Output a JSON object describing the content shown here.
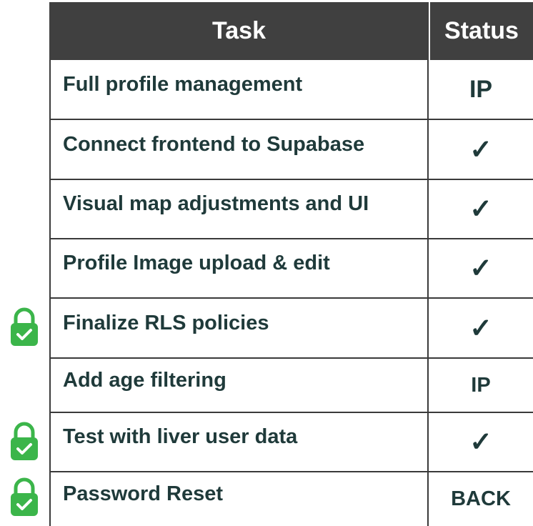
{
  "header": {
    "task": "Task",
    "status": "Status"
  },
  "rows": [
    {
      "task": "Full profile management",
      "status": "IP",
      "locked": false
    },
    {
      "task": "Connect frontend to Supabase",
      "status": "✓",
      "locked": false
    },
    {
      "task": "Visual map adjustments and UI",
      "status": "✓",
      "locked": false
    },
    {
      "task": "Profile Image upload & edit",
      "status": "✓",
      "locked": false
    },
    {
      "task": "Finalize RLS policies",
      "status": "✓",
      "locked": true
    },
    {
      "task": "Add age filtering",
      "status": "IP",
      "locked": false
    },
    {
      "task": "Test with liver user data",
      "status": "✓",
      "locked": true
    },
    {
      "task": "Password Reset",
      "status": "BACK",
      "locked": true
    }
  ],
  "colors": {
    "header_bg": "#404040",
    "text": "#1f3a3a",
    "lock_icon": "#3bb54a"
  },
  "icons": {
    "lock": "lock-check-icon"
  }
}
